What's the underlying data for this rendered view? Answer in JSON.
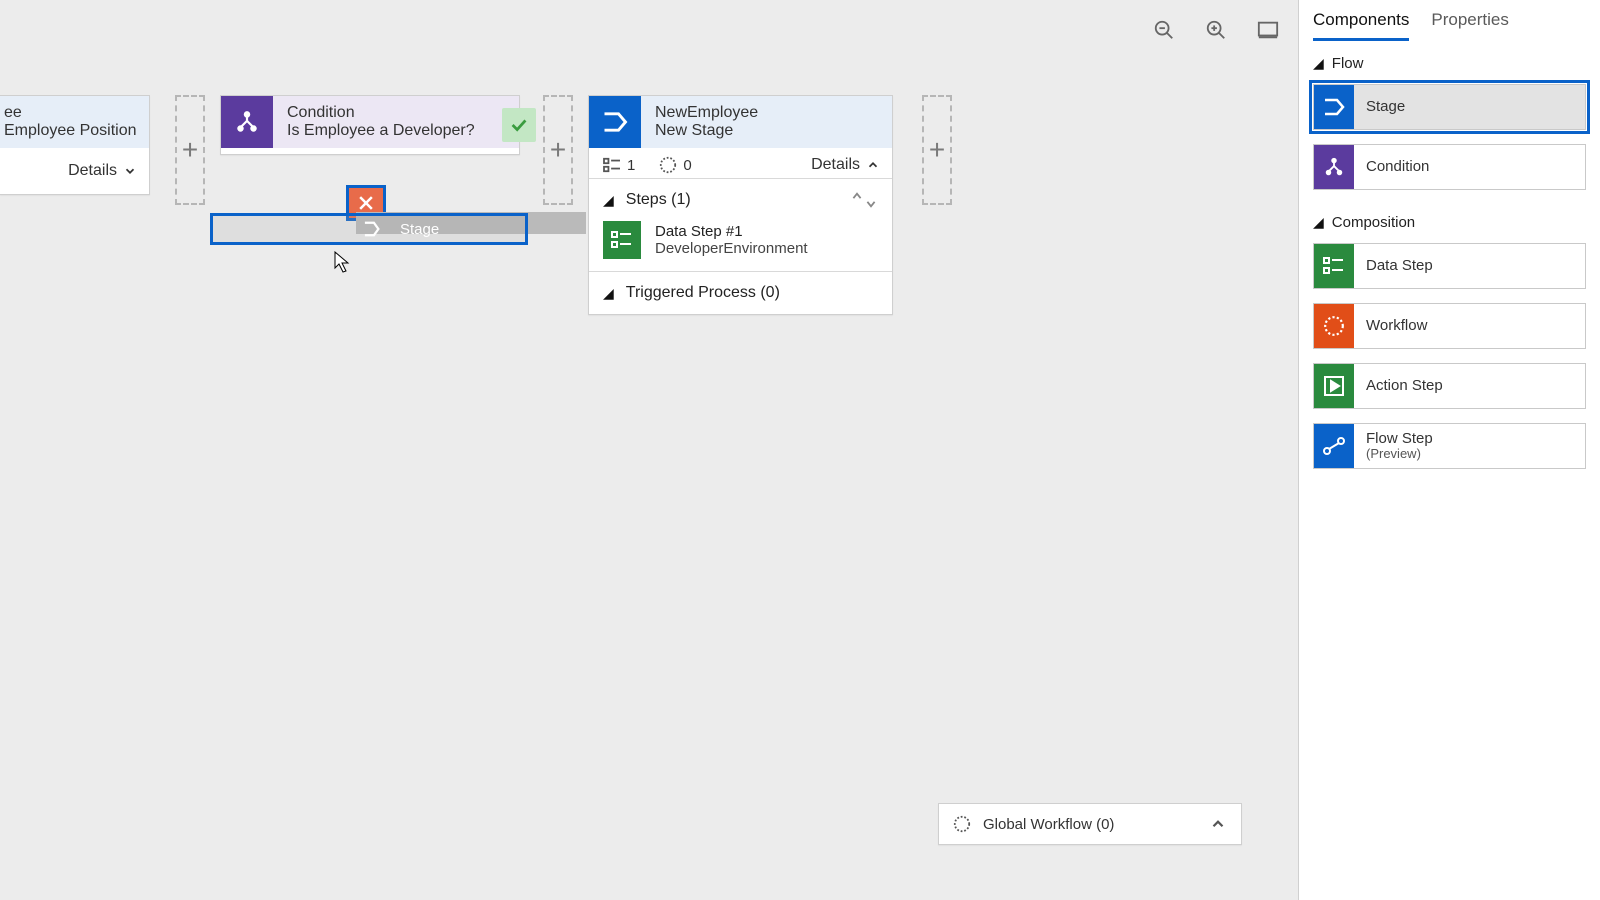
{
  "canvas": {
    "position_node": {
      "line1": "ee",
      "line2": "Employee Position",
      "details": "Details"
    },
    "condition_node": {
      "title": "Condition",
      "subtitle": "Is Employee a Developer?"
    },
    "drag_ghost_label": "Stage",
    "newemployee_node": {
      "title": "NewEmployee",
      "subtitle": "New Stage",
      "steps_count": "1",
      "workflow_count": "0",
      "details": "Details",
      "steps_label": "Steps (1)",
      "data_step_title": "Data Step #1",
      "data_step_sub": "DeveloperEnvironment",
      "triggered_label": "Triggered Process (0)"
    },
    "global_workflow_label": "Global Workflow (0)"
  },
  "sidepanel": {
    "tabs": {
      "components": "Components",
      "properties": "Properties"
    },
    "section_flow": "Flow",
    "section_composition": "Composition",
    "items": {
      "stage": "Stage",
      "condition": "Condition",
      "data_step": "Data Step",
      "workflow": "Workflow",
      "action_step": "Action Step",
      "flow_step": "Flow Step",
      "flow_step_sub": "(Preview)"
    }
  }
}
